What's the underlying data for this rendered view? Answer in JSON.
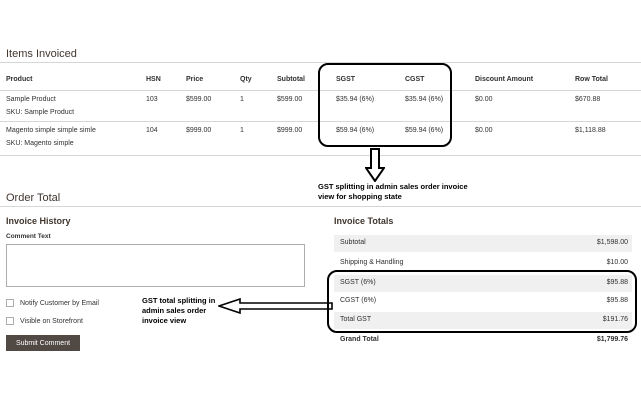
{
  "items_invoiced": {
    "title": "Items Invoiced",
    "columns": {
      "product": "Product",
      "hsn": "HSN",
      "price": "Price",
      "qty": "Qty",
      "subtotal": "Subtotal",
      "sgst": "SGST",
      "cgst": "CGST",
      "discount": "Discount Amount",
      "row_total": "Row Total"
    },
    "rows": [
      {
        "product": "Sample Product",
        "sku": "SKU: Sample Product",
        "hsn": "103",
        "price": "$599.00",
        "qty": "1",
        "subtotal": "$599.00",
        "sgst": "$35.94 (6%)",
        "cgst": "$35.94 (6%)",
        "discount": "$0.00",
        "row_total": "$670.88"
      },
      {
        "product": "Magento simple simple simle",
        "sku": "SKU: Magento simple",
        "hsn": "104",
        "price": "$999.00",
        "qty": "1",
        "subtotal": "$999.00",
        "sgst": "$59.94 (6%)",
        "cgst": "$59.94 (6%)",
        "discount": "$0.00",
        "row_total": "$1,118.88"
      }
    ]
  },
  "annotation_top": {
    "line1": "GST splitting in admin sales order invoice",
    "line2": "view for shopping state"
  },
  "order_total": {
    "title": "Order Total"
  },
  "invoice_history": {
    "title": "Invoice History",
    "comment_label": "Comment Text",
    "notify_label": "Notify Customer by Email",
    "visible_label": "Visible on Storefront",
    "submit_label": "Submit Comment"
  },
  "annotation_left": {
    "line1": "GST total splitting in",
    "line2": "admin sales order",
    "line3": "invoice view"
  },
  "invoice_totals": {
    "title": "Invoice Totals",
    "rows": [
      {
        "label": "Subtotal",
        "value": "$1,598.00"
      },
      {
        "label": "Shipping & Handling",
        "value": "$10.00"
      },
      {
        "label": "SGST (6%)",
        "value": "$95.88"
      },
      {
        "label": "CGST (6%)",
        "value": "$95.88"
      },
      {
        "label": "Total GST",
        "value": "$191.76"
      },
      {
        "label": "Grand Total",
        "value": "$1,799.76"
      }
    ]
  }
}
